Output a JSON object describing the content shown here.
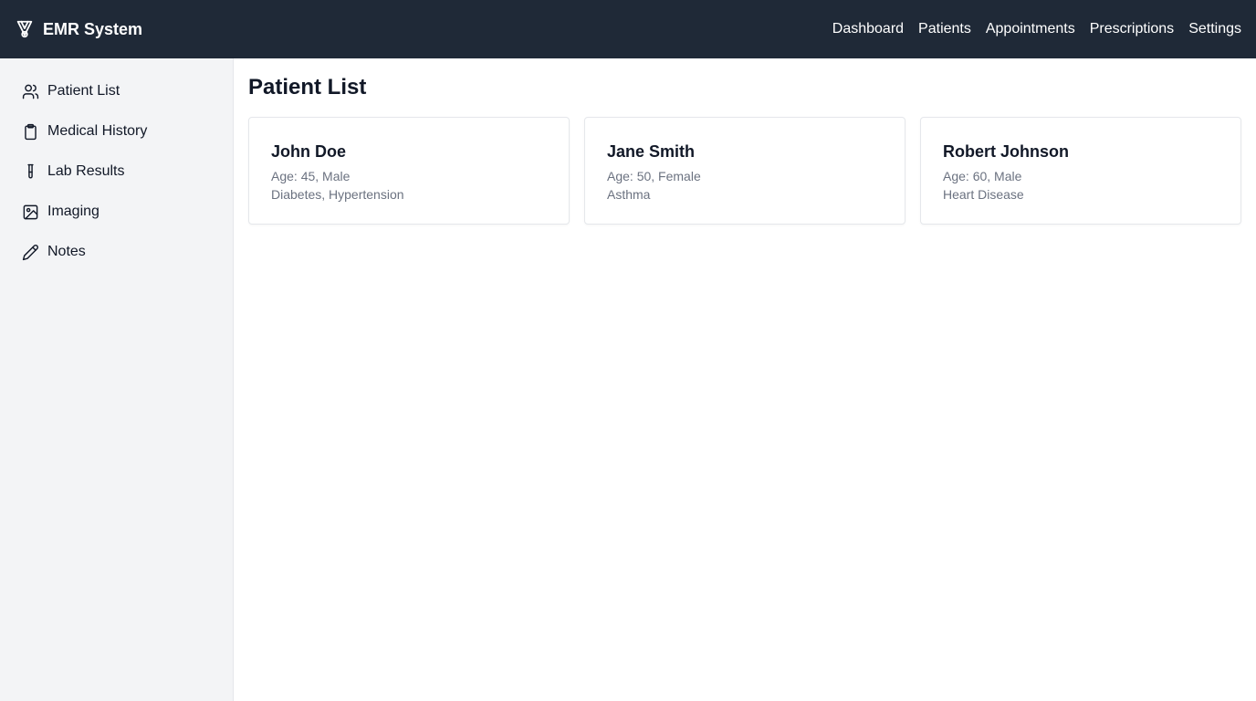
{
  "header": {
    "brand": "EMR System",
    "nav": [
      {
        "label": "Dashboard"
      },
      {
        "label": "Patients"
      },
      {
        "label": "Appointments"
      },
      {
        "label": "Prescriptions"
      },
      {
        "label": "Settings"
      }
    ]
  },
  "sidebar": {
    "items": [
      {
        "label": "Patient List",
        "icon": "users-icon"
      },
      {
        "label": "Medical History",
        "icon": "clipboard-icon"
      },
      {
        "label": "Lab Results",
        "icon": "test-tube-icon"
      },
      {
        "label": "Imaging",
        "icon": "image-icon"
      },
      {
        "label": "Notes",
        "icon": "pencil-icon"
      }
    ]
  },
  "main": {
    "title": "Patient List",
    "patients": [
      {
        "name": "John Doe",
        "details": "Age: 45, Male",
        "conditions": "Diabetes, Hypertension"
      },
      {
        "name": "Jane Smith",
        "details": "Age: 50, Female",
        "conditions": "Asthma"
      },
      {
        "name": "Robert Johnson",
        "details": "Age: 60, Male",
        "conditions": "Heart Disease"
      }
    ]
  },
  "colors": {
    "topbar": "#1f2937",
    "sidebar": "#f3f4f6",
    "muted_text": "#6b7280"
  }
}
